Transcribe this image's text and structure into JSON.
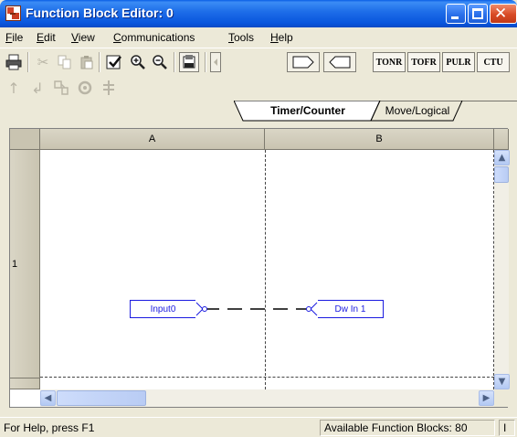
{
  "window": {
    "title": "Function Block Editor: 0"
  },
  "menu": [
    {
      "pre": "",
      "ul": "F",
      "post": "ile"
    },
    {
      "pre": "",
      "ul": "E",
      "post": "dit"
    },
    {
      "pre": "",
      "ul": "V",
      "post": "iew"
    },
    {
      "pre": "",
      "ul": "C",
      "post": "ommunications"
    },
    {
      "pre": "",
      "ul": "T",
      "post": "ools"
    },
    {
      "pre": "",
      "ul": "H",
      "post": "elp"
    }
  ],
  "toolbar": {
    "fb_buttons": [
      "TONR",
      "TOFR",
      "PULR",
      "CTU"
    ]
  },
  "tabs": [
    "Timer/Counter",
    "Move/Logical"
  ],
  "grid": {
    "columns": [
      "A",
      "B"
    ],
    "rows": [
      "1"
    ]
  },
  "blocks": {
    "input": "Input0",
    "output": "Dw In 1"
  },
  "status": {
    "help": "For Help, press F1",
    "available": "Available Function Blocks: 80",
    "extra": "I"
  }
}
